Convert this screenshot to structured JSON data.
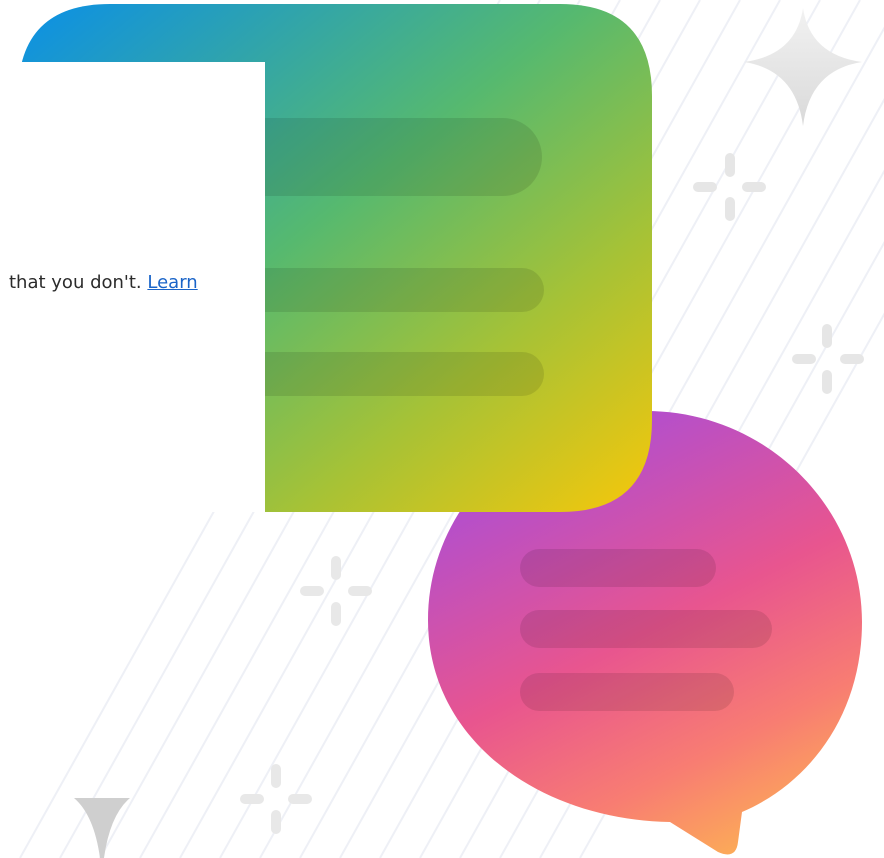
{
  "illustration": {
    "document_gradient": [
      "#0a8fe8",
      "#56b96f",
      "#a6c236",
      "#f7c70a"
    ],
    "bubble_gradient": [
      "#a64ddc",
      "#e8558f",
      "#f87d72",
      "#fcae56"
    ]
  },
  "dialog": {
    "message_text": "that you don't.",
    "link_text": "Learn"
  }
}
